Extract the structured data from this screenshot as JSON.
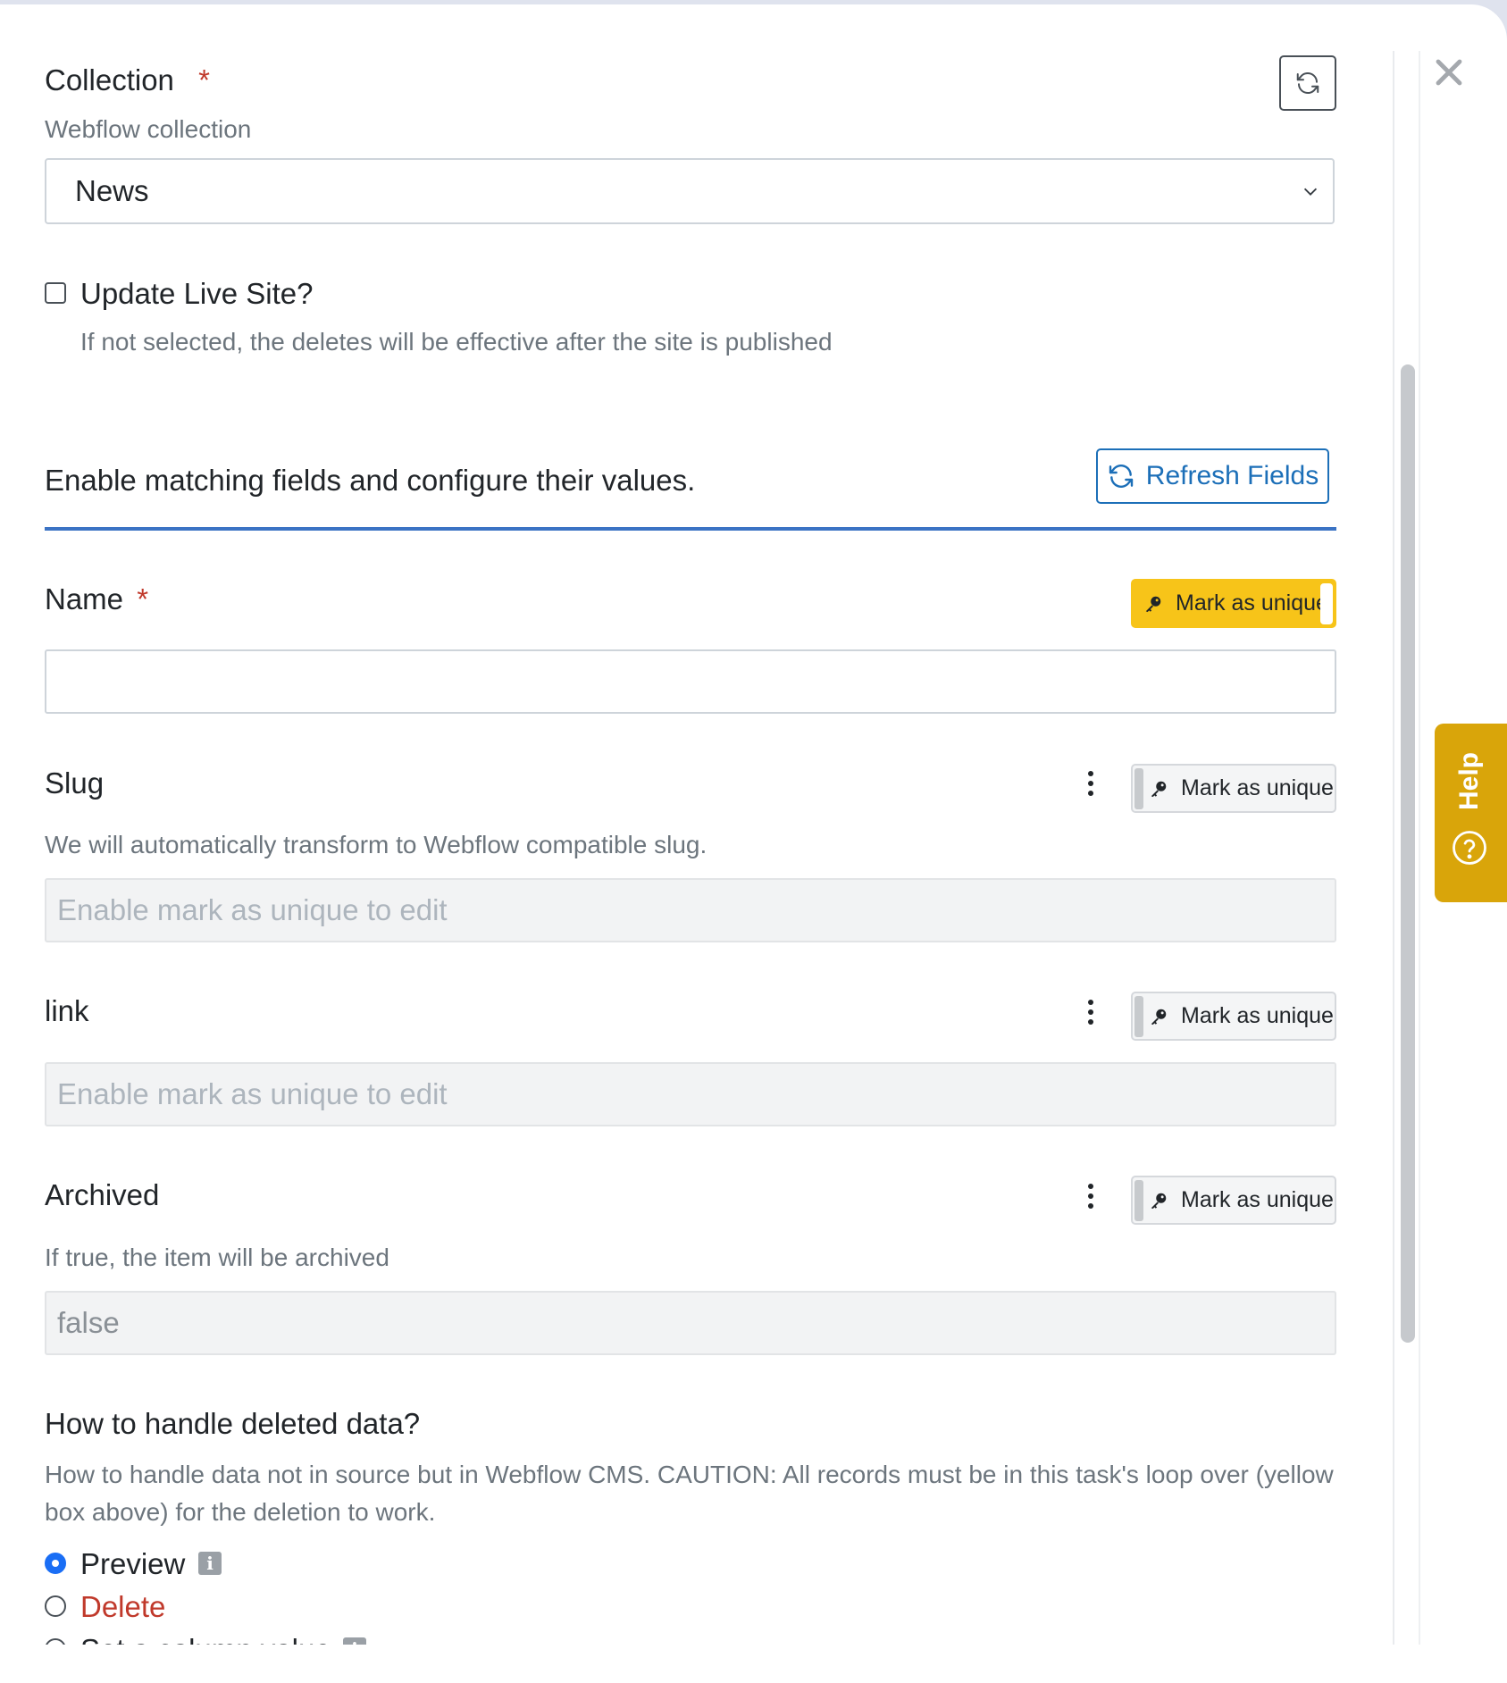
{
  "collection": {
    "label": "Collection",
    "required_mark": "*",
    "help": "Webflow collection",
    "selected": "News",
    "refresh_icon": "refresh-icon"
  },
  "update_live": {
    "label": "Update Live Site?",
    "help": "If not selected, the deletes will be effective after the site is published",
    "checked": false
  },
  "fields_section": {
    "title": "Enable matching fields and configure their values.",
    "refresh_label": "Refresh Fields"
  },
  "fields": {
    "name": {
      "label": "Name",
      "required_mark": "*",
      "unique_label": "Mark as unique",
      "value": ""
    },
    "slug": {
      "label": "Slug",
      "help": "We will automatically transform to Webflow compatible slug.",
      "unique_label": "Mark as unique",
      "placeholder": "Enable mark as unique to edit"
    },
    "link": {
      "label": "link",
      "unique_label": "Mark as unique",
      "placeholder": "Enable mark as unique to edit"
    },
    "archived": {
      "label": "Archived",
      "help": "If true, the item will be archived",
      "unique_label": "Mark as unique",
      "value": "false"
    }
  },
  "deleted_data": {
    "title": "How to handle deleted data?",
    "help": "How to handle data not in source but in Webflow CMS. CAUTION: All records must be in this task's loop over (yellow box above) for the deletion to work.",
    "options": [
      {
        "label": "Preview",
        "selected": true
      },
      {
        "label": "Delete",
        "selected": false,
        "color": "#c0392b"
      },
      {
        "label": "Set a column value",
        "selected": false
      }
    ],
    "info_glyph": "i"
  },
  "help_tab": {
    "label": "Help",
    "icon": "question-circle-icon",
    "color": "#d9a50a"
  },
  "colors": {
    "accent": "#1c6fb8",
    "unique_on": "#f7c419",
    "required": "#c0392b"
  }
}
